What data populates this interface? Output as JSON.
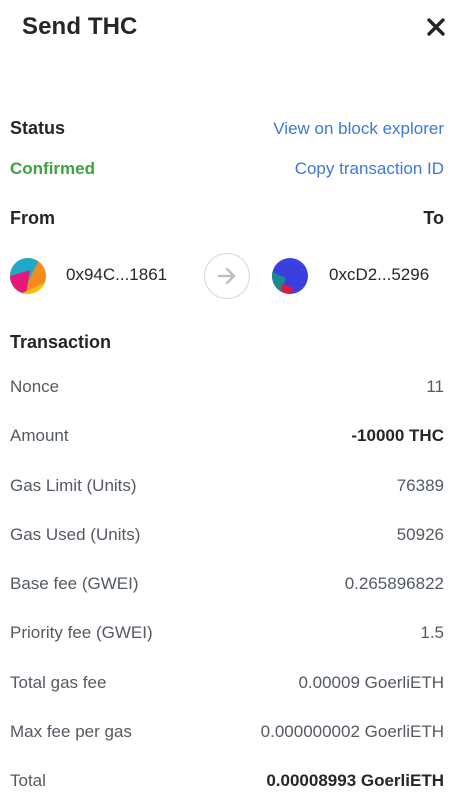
{
  "header": {
    "title": "Send THC"
  },
  "status": {
    "label": "Status",
    "value": "Confirmed",
    "view_explorer_link": "View on block explorer",
    "copy_tx_link": "Copy transaction ID"
  },
  "parties": {
    "from_label": "From",
    "to_label": "To",
    "from_address": "0x94C...1861",
    "to_address": "0xcD2...5296"
  },
  "transaction": {
    "heading": "Transaction",
    "rows": [
      {
        "label": "Nonce",
        "value": "11"
      },
      {
        "label": "Amount",
        "value": "-10000 THC"
      },
      {
        "label": "Gas Limit (Units)",
        "value": "76389"
      },
      {
        "label": "Gas Used (Units)",
        "value": "50926"
      },
      {
        "label": "Base fee (GWEI)",
        "value": "0.265896822"
      },
      {
        "label": "Priority fee (GWEI)",
        "value": "1.5"
      },
      {
        "label": "Total gas fee",
        "value": "0.00009 GoerliETH"
      },
      {
        "label": "Max fee per gas",
        "value": "0.000000002 GoerliETH"
      },
      {
        "label": "Total",
        "value": "0.00008993 GoerliETH"
      }
    ]
  },
  "colors": {
    "link": "#3b7ad8",
    "confirmed": "#3da33f",
    "text_primary": "#24272a",
    "text_secondary": "#535a61"
  },
  "icons": {
    "close": "close-icon",
    "arrow": "arrow-right-icon"
  }
}
